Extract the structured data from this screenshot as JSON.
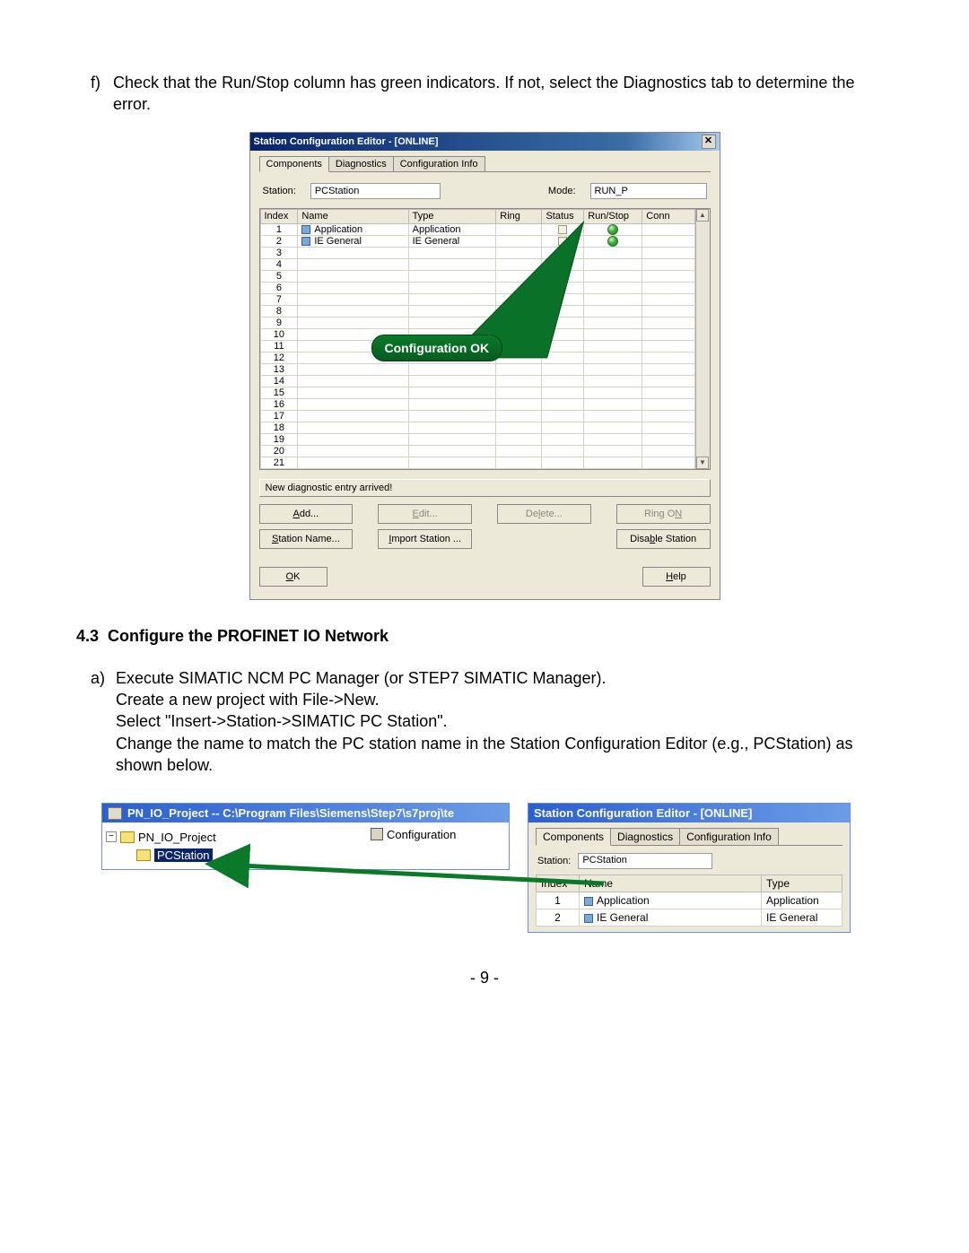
{
  "body": {
    "step_f_label": "f)",
    "step_f": "Check that the Run/Stop column has green indicators.  If not, select the Diagnostics tab to determine the error.",
    "section_num": "4.3",
    "section_title": "Configure the PROFINET IO Network",
    "step_a_label": "a)",
    "step_a_lines": [
      "Execute SIMATIC NCM PC Manager (or STEP7 SIMATIC Manager).",
      "Create a new project with File->New.",
      "Select \"Insert->Station->SIMATIC PC Station\".",
      "Change the name to match the PC station name in the Station Configuration Editor (e.g., PCStation) as shown below."
    ],
    "page_number": "- 9 -"
  },
  "dlg": {
    "title": "Station Configuration Editor - [ONLINE]",
    "tabs": {
      "t1": "Components",
      "t2": "Diagnostics",
      "t3": "Configuration Info"
    },
    "labels": {
      "station": "Station:",
      "mode": "Mode:"
    },
    "values": {
      "station": "PCStation",
      "mode": "RUN_P"
    },
    "cols": {
      "index": "Index",
      "name": "Name",
      "type": "Type",
      "ring": "Ring",
      "status": "Status",
      "runstop": "Run/Stop",
      "conn": "Conn"
    },
    "rows": [
      {
        "index": "1",
        "name": "Application",
        "type": "Application",
        "green": true
      },
      {
        "index": "2",
        "name": "IE General",
        "type": "IE General",
        "green": true
      }
    ],
    "empty_rows": [
      "3",
      "4",
      "5",
      "6",
      "7",
      "8",
      "9",
      "10",
      "11",
      "12",
      "13",
      "14",
      "15",
      "16",
      "17",
      "18",
      "19",
      "20",
      "21"
    ],
    "callout": "Configuration OK",
    "status_line": "New diagnostic entry arrived!",
    "buttons": {
      "add": "Add...",
      "edit": "Edit...",
      "delete": "Delete...",
      "ring_on": "Ring ON",
      "station_name": "Station Name...",
      "import": "Import Station ...",
      "disable": "Disable Station",
      "ok": "OK",
      "help": "Help"
    }
  },
  "fig2": {
    "proj_title": "PN_IO_Project -- C:\\Program Files\\Siemens\\Step7\\s7proj\\te",
    "tree_root": "PN_IO_Project",
    "tree_sel": "PCStation",
    "right_item": "Configuration",
    "dlg2_title": "Station Configuration Editor - [ONLINE]",
    "tabs": {
      "t1": "Components",
      "t2": "Diagnostics",
      "t3": "Configuration Info"
    },
    "station_label": "Station:",
    "station_value": "PCStation",
    "cols": {
      "index": "Index",
      "name": "Name",
      "type": "Type"
    },
    "rows": [
      {
        "index": "1",
        "name": "Application",
        "type": "Application"
      },
      {
        "index": "2",
        "name": "IE General",
        "type": "IE General"
      }
    ]
  }
}
